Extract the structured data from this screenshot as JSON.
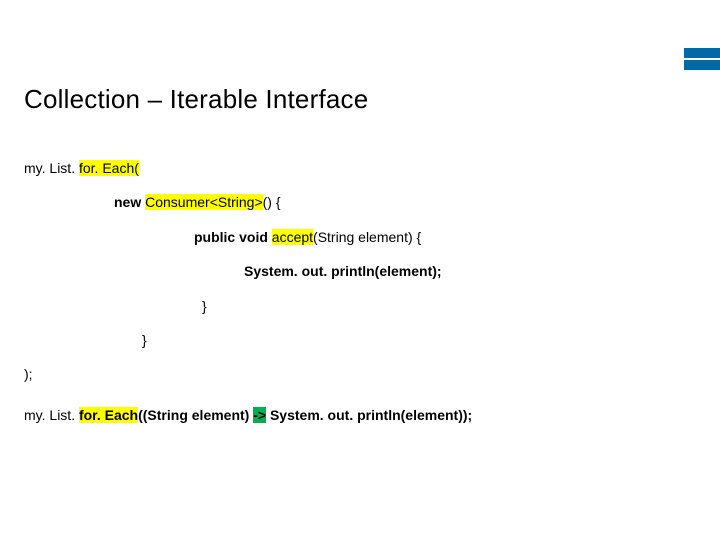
{
  "title": "Collection – Iterable Interface",
  "code": {
    "l1a": "my. List. ",
    "l1b": "for. Each(",
    "l2a": "new ",
    "l2b": "Consumer<String>",
    "l2c": "() {",
    "l3a": "public void ",
    "l3b": "accept",
    "l3c": "(String element) {",
    "l4": "System. out. println(element);",
    "l5": "}",
    "l6": "}",
    "l7": ");",
    "l8a": "my. List. ",
    "l8b": "for. Each",
    "l8c": "((String element) ",
    "l8d": "->",
    "l8e": " System. out. println(element));"
  }
}
